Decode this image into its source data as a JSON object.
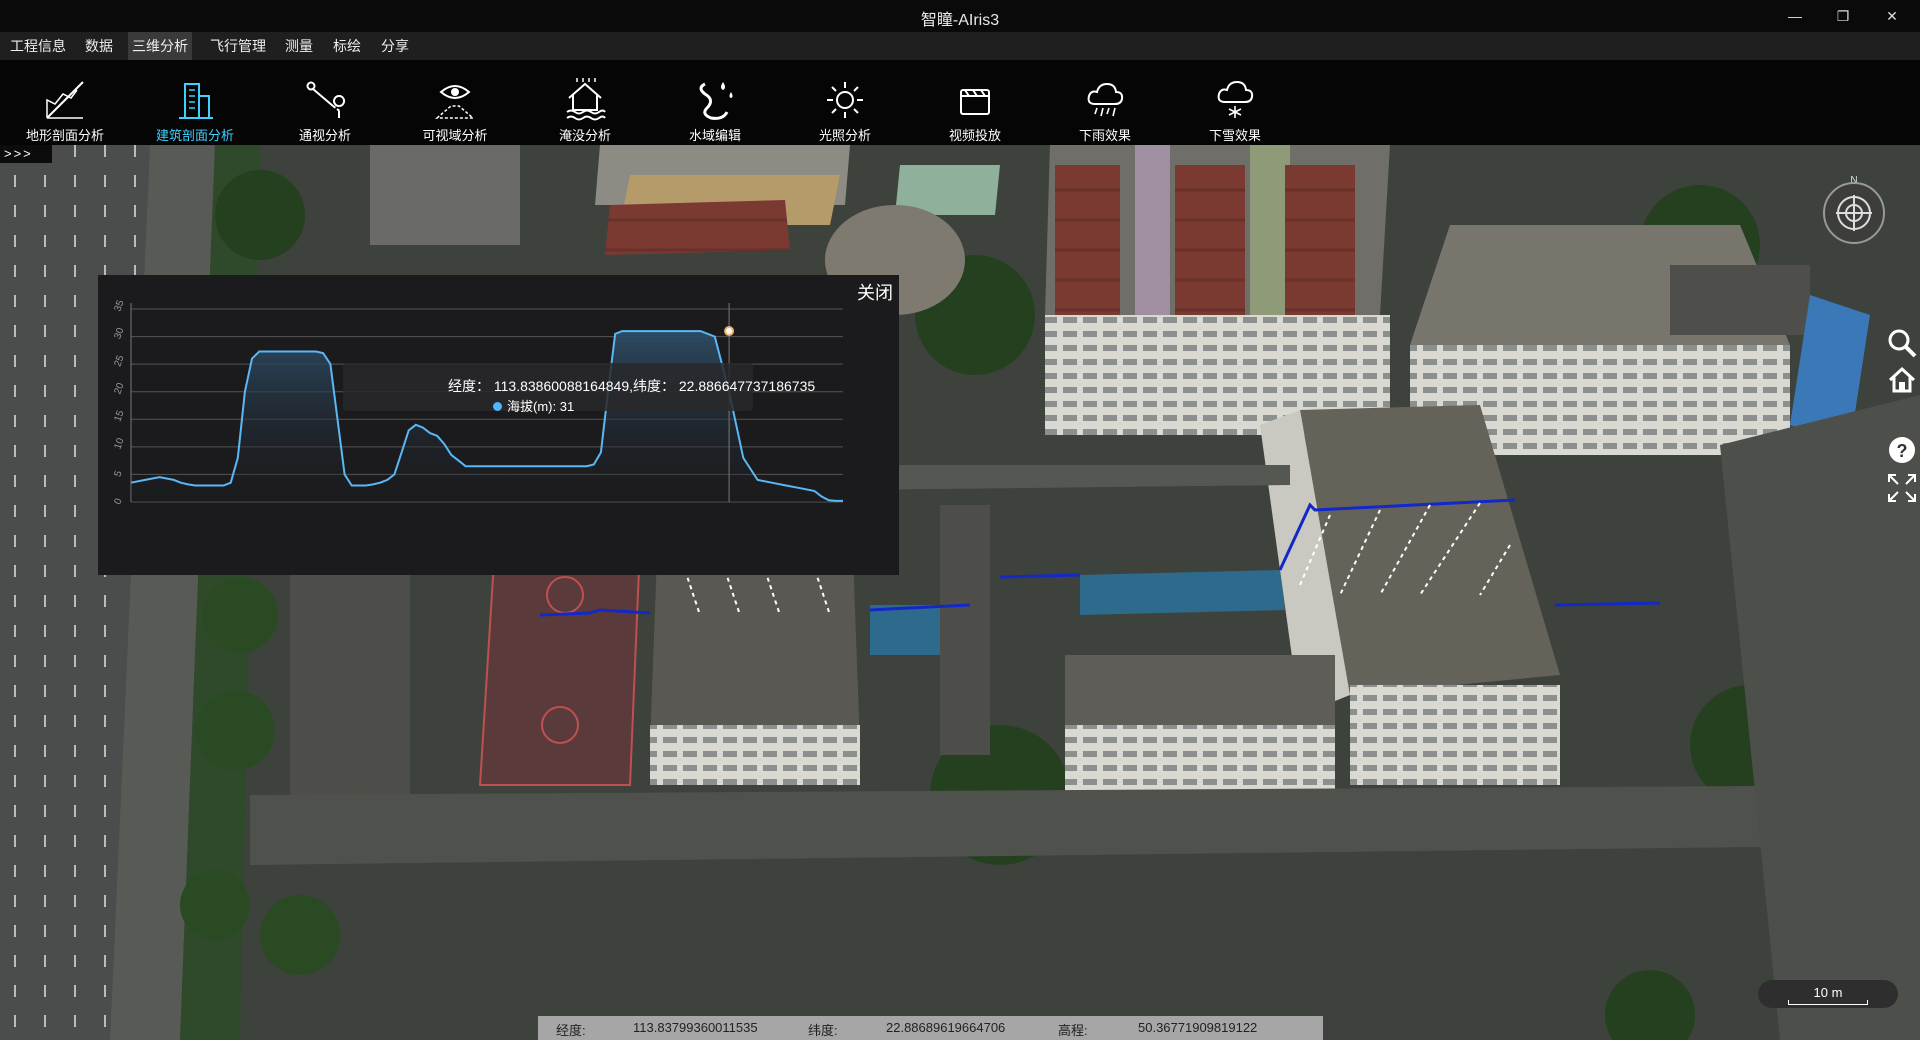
{
  "app": {
    "title": "智瞳-AIris3"
  },
  "window": {
    "minimize": "—",
    "restore": "❐",
    "close": "✕"
  },
  "menu": {
    "items": [
      {
        "label": "工程信息"
      },
      {
        "label": "数据"
      },
      {
        "label": "三维分析"
      },
      {
        "label": "飞行管理"
      },
      {
        "label": "测量"
      },
      {
        "label": "标绘"
      },
      {
        "label": "分享"
      }
    ],
    "active_index": 2,
    "message_count": "0"
  },
  "toolbar": {
    "tools": [
      {
        "label": "地形剖面分析",
        "icon": "terrain-profile-icon"
      },
      {
        "label": "建筑剖面分析",
        "icon": "building-profile-icon"
      },
      {
        "label": "通视分析",
        "icon": "line-of-sight-icon"
      },
      {
        "label": "可视域分析",
        "icon": "viewshed-icon"
      },
      {
        "label": "淹没分析",
        "icon": "flood-icon"
      },
      {
        "label": "水域编辑",
        "icon": "water-edit-icon"
      },
      {
        "label": "光照分析",
        "icon": "sunlight-icon"
      },
      {
        "label": "视频投放",
        "icon": "video-projection-icon"
      },
      {
        "label": "下雨效果",
        "icon": "rain-icon"
      },
      {
        "label": "下雪效果",
        "icon": "snow-icon"
      }
    ],
    "active_index": 1
  },
  "expander": {
    "label": ">>>"
  },
  "profile_panel": {
    "close_label": "关闭",
    "tooltip": {
      "coords": "经度： 113.83860088164849,纬度： 22.886647737186735",
      "value": "海拔(m): 31"
    }
  },
  "compass": {
    "north": "N"
  },
  "scale": {
    "label": "10 m"
  },
  "status": {
    "lon_label": "经度:",
    "lon_value": "113.83799360011535",
    "lat_label": "纬度:",
    "lat_value": "22.88689619664706",
    "alt_label": "高程:",
    "alt_value": "50.36771909819122"
  },
  "chart_data": {
    "type": "area",
    "ylabel": "",
    "ylim": [
      0,
      35
    ],
    "yticks": [
      "0",
      "5",
      "10",
      "15",
      "20",
      "25",
      "30",
      "35"
    ],
    "x": [
      0,
      2,
      4,
      6,
      7,
      8,
      9,
      10,
      11,
      12,
      13,
      14,
      15,
      16,
      17,
      18,
      19,
      20,
      21,
      22,
      23,
      24,
      25,
      26,
      27,
      28,
      29,
      30,
      31,
      32,
      33,
      34,
      35,
      36,
      37,
      38,
      39,
      40,
      41,
      42,
      43,
      44,
      45,
      46,
      47,
      48,
      49,
      50,
      51,
      52,
      53,
      54,
      55,
      56,
      57,
      58,
      59,
      60,
      61,
      62,
      63,
      64,
      65,
      66,
      67,
      68,
      69,
      70,
      71,
      72,
      73,
      74,
      75,
      76,
      77,
      78,
      79,
      80,
      82,
      84,
      86,
      88,
      90,
      92,
      94,
      96,
      97,
      98,
      99,
      100
    ],
    "values": [
      3.5,
      4,
      4.5,
      4,
      3.5,
      3.2,
      3,
      3,
      3,
      3,
      3,
      3.5,
      8,
      20,
      26,
      27.3,
      27.3,
      27.3,
      27.3,
      27.3,
      27.3,
      27.3,
      27.3,
      27.3,
      27,
      25,
      15,
      5,
      3,
      3,
      3,
      3.2,
      3.5,
      4,
      5,
      9,
      13,
      14,
      13.5,
      12.5,
      12,
      10.5,
      8.5,
      7.5,
      6.5,
      6.5,
      6.5,
      6.5,
      6.5,
      6.5,
      6.5,
      6.5,
      6.5,
      6.5,
      6.5,
      6.5,
      6.5,
      6.5,
      6.5,
      6.5,
      6.5,
      6.5,
      6.8,
      9,
      20,
      30.5,
      31,
      31,
      31,
      31,
      31,
      31,
      31,
      31,
      31,
      31,
      31,
      31,
      30,
      20,
      8,
      4,
      3.5,
      3,
      2.5,
      2,
      1,
      0.3,
      0.2,
      0.2,
      0.2,
      0.2
    ],
    "highlight_x": 84,
    "highlight_value": 31,
    "grid": true,
    "colors": {
      "line": "#5ab8f5",
      "fill_top": "#2e4d68",
      "fill_bottom": "#1b1b1d",
      "grid": "#555555"
    }
  }
}
